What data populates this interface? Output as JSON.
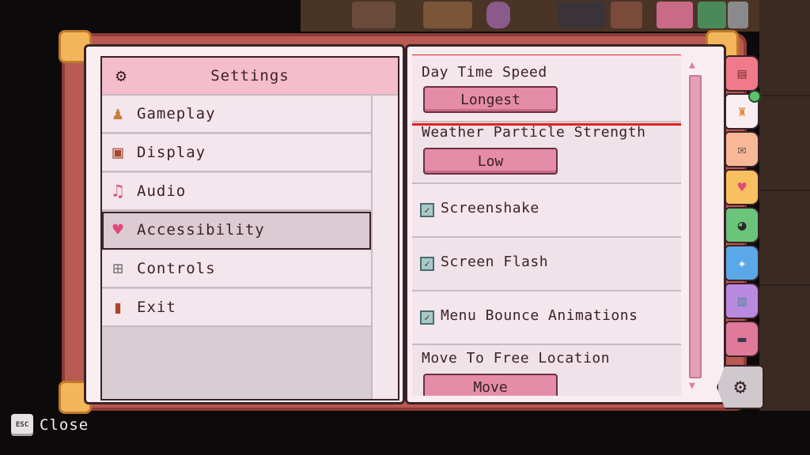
{
  "nav": {
    "header": {
      "label": "Settings",
      "icon": "gear-icon"
    },
    "items": [
      {
        "label": "Gameplay",
        "icon": "character-icon"
      },
      {
        "label": "Display",
        "icon": "tv-icon"
      },
      {
        "label": "Audio",
        "icon": "music-note-icon"
      },
      {
        "label": "Accessibility",
        "icon": "heart-icon",
        "selected": true
      },
      {
        "label": "Controls",
        "icon": "gamepad-icon"
      },
      {
        "label": "Exit",
        "icon": "door-icon"
      }
    ]
  },
  "settings": {
    "day_time_speed": {
      "label": "Day Time Speed",
      "value": "Longest"
    },
    "weather_particle_strength": {
      "label": "Weather Particle Strength",
      "value": "Low"
    },
    "screenshake": {
      "label": "Screenshake",
      "checked": true
    },
    "screen_flash": {
      "label": "Screen Flash",
      "checked": true
    },
    "menu_bounce_animations": {
      "label": "Menu Bounce Animations",
      "checked": true
    },
    "move_to_free_location": {
      "label": "Move To Free Location",
      "value": "Move"
    }
  },
  "tabs": [
    {
      "icon": "backpack-icon",
      "color": "#f07a8a"
    },
    {
      "icon": "shirt-icon",
      "color": "#f8eef2",
      "badge": true
    },
    {
      "icon": "mail-icon",
      "color": "#f8b898"
    },
    {
      "icon": "heart-icon",
      "color": "#f8c060"
    },
    {
      "icon": "cow-icon",
      "color": "#6ac47a"
    },
    {
      "icon": "sparkle-icon",
      "color": "#5aa8e8"
    },
    {
      "icon": "map-icon",
      "color": "#b88ae0"
    },
    {
      "icon": "computer-icon",
      "color": "#e07a9a"
    },
    {
      "icon": "gear-icon",
      "color": "#cfc8cc"
    }
  ],
  "footer": {
    "key": "ESC",
    "label": "Close"
  },
  "colors": {
    "highlight": "#e02020",
    "accent": "#e48ca8"
  }
}
